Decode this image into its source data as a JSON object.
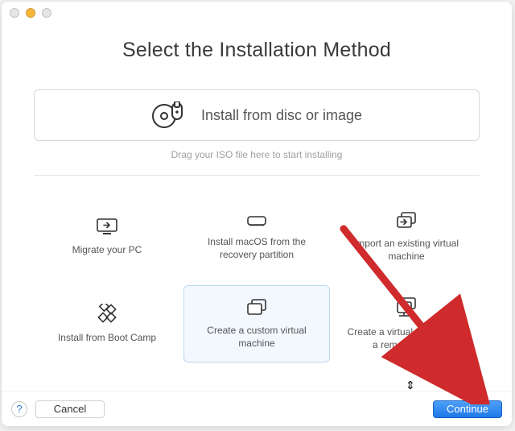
{
  "title": "Select the Installation Method",
  "top_option": {
    "label": "Install from disc or image",
    "hint": "Drag your ISO file here to start installing"
  },
  "options": [
    {
      "label": "Migrate your PC",
      "selected": false
    },
    {
      "label": "Install macOS from the recovery partition",
      "selected": false
    },
    {
      "label": "Import an existing virtual machine",
      "selected": false
    },
    {
      "label": "Install from Boot Camp",
      "selected": false
    },
    {
      "label": "Create a custom virtual machine",
      "selected": true
    },
    {
      "label": "Create a virtual machine on a remote server",
      "selected": false
    }
  ],
  "footer": {
    "help": "?",
    "cancel": "Cancel",
    "continue": "Continue"
  },
  "annotation": {
    "arrow_color": "#cf2b2c"
  }
}
